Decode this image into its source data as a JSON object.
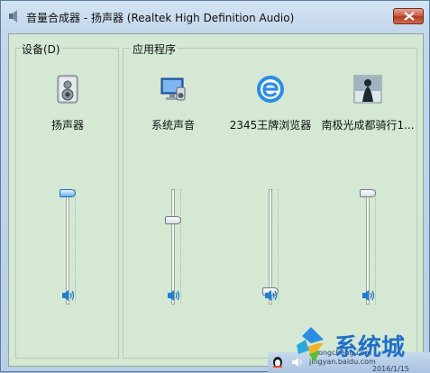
{
  "window": {
    "title": "音量合成器 - 扬声器 (Realtek High Definition Audio)"
  },
  "device_group": {
    "label": "设备(D)",
    "name": "扬声器",
    "volume_percent": 100
  },
  "apps_group": {
    "label": "应用程序",
    "apps": [
      {
        "name": "系统声音",
        "icon": "system-sounds-icon",
        "volume_percent": 75
      },
      {
        "name": "2345王牌浏览器",
        "icon": "browser-e-icon",
        "volume_percent": 8
      },
      {
        "name": "南极光成都骑行1...",
        "icon": "video-thumbnail-icon",
        "volume_percent": 100
      }
    ]
  },
  "watermark": {
    "logo_text": "系统城"
  },
  "tray": {
    "text1": "jingyan.baidu.com",
    "text2": "xitongcheng.com",
    "text3": "2016/1/15"
  },
  "colors": {
    "client_bg": "#d4e8d4",
    "accent": "#1f7fd0",
    "close": "#c9553e"
  }
}
